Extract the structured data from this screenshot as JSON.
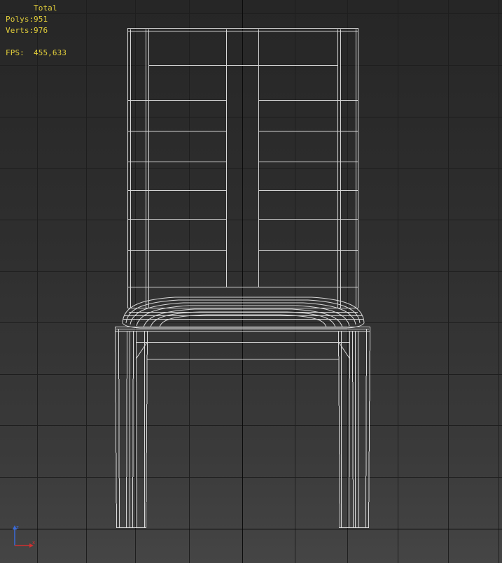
{
  "stats": {
    "header": "Total",
    "polys_label": "Polys:",
    "polys_value": "951",
    "verts_label": "Verts:",
    "verts_value": "976",
    "fps_label": "FPS:",
    "fps_value": "455,633"
  },
  "colors": {
    "stats_text": "#e3cf3b",
    "grid_line": "#1e1e1e",
    "grid_axis": "#0a0a0a",
    "wireframe": "#d8d8d8",
    "gizmo_x": "#d03030",
    "gizmo_z": "#3a6ad8"
  },
  "viewport": {
    "object": "chair-wireframe",
    "view": "front",
    "grid": true
  }
}
